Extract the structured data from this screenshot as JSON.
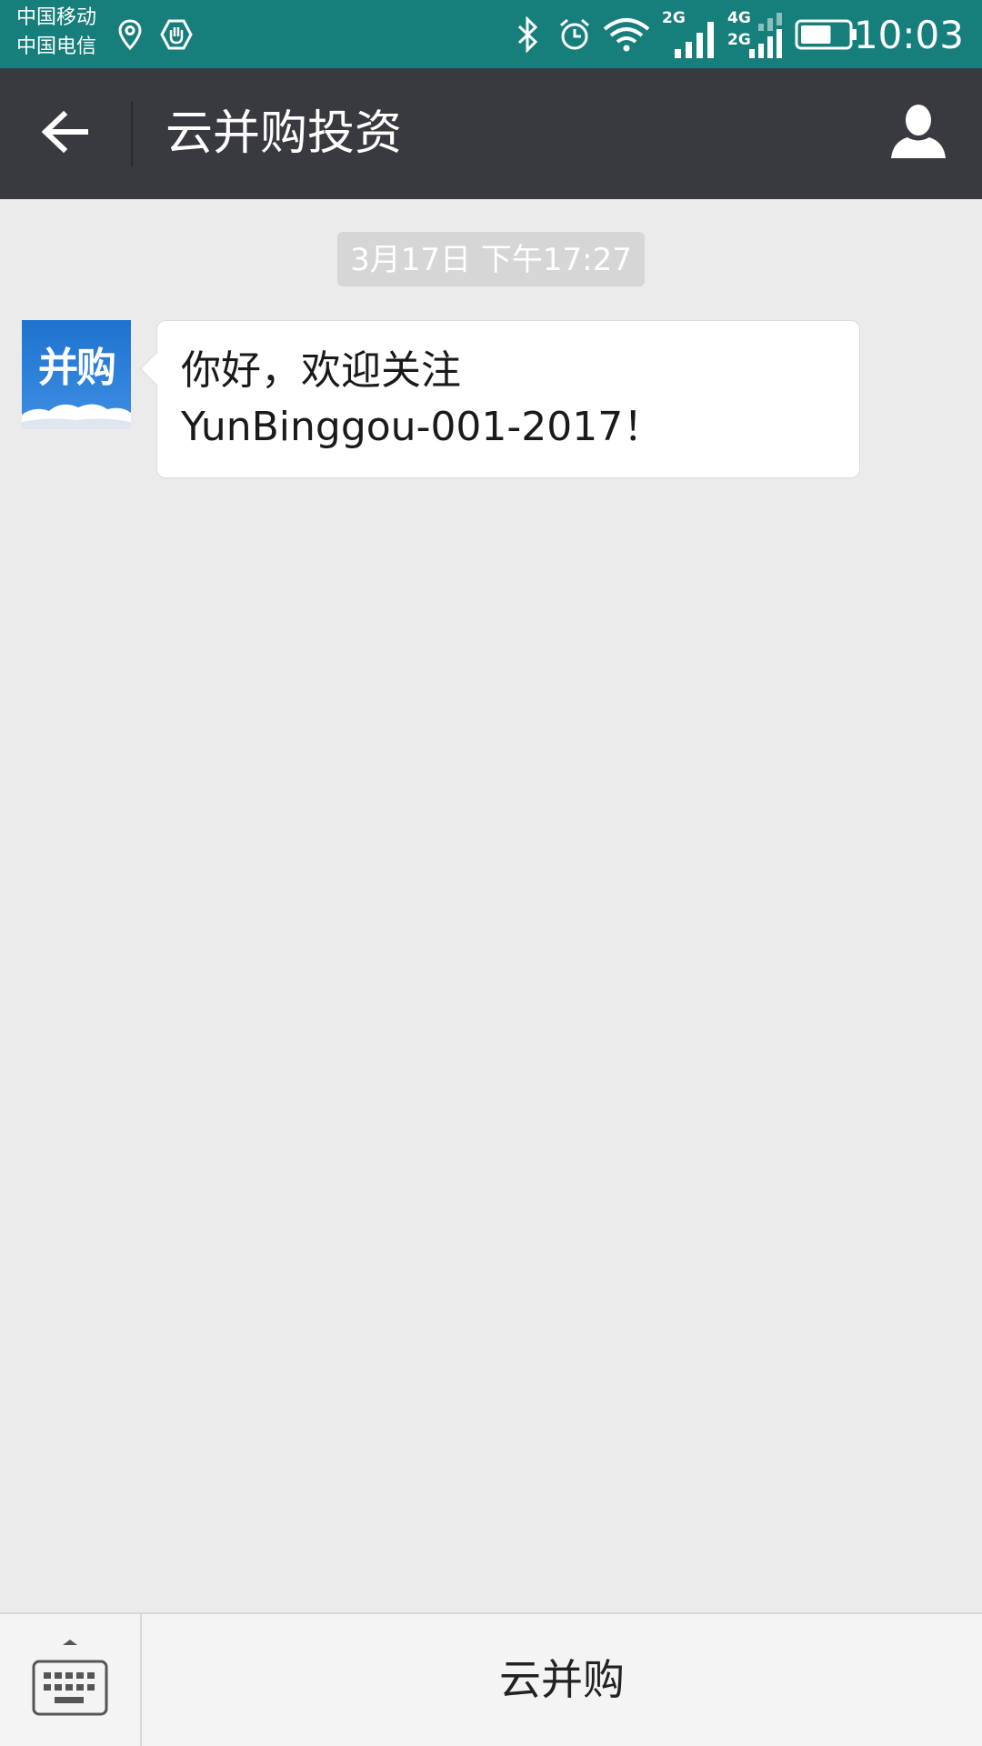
{
  "status_bar": {
    "carrier_1": "中国移动",
    "carrier_2": "中国电信",
    "net_1": "2G",
    "net_2_top": "4G",
    "net_2_bottom": "2G",
    "time": "10:03",
    "icons": [
      "location-icon",
      "hand-icon",
      "bluetooth-icon",
      "alarm-icon",
      "wifi-icon",
      "signal-icon",
      "battery-icon"
    ],
    "battery_level": 0.65
  },
  "header": {
    "title": "云并购投资",
    "back_icon": "arrow-left-icon",
    "profile_icon": "person-icon"
  },
  "chat": {
    "timestamp": "3月17日 下午17:27",
    "messages": [
      {
        "avatar_text": "并购",
        "line_1": "你好，欢迎关注",
        "line_2": "YunBinggou-001-2017！"
      }
    ]
  },
  "bottom_bar": {
    "keyboard_icon": "keyboard-icon",
    "menu_label": "云并购"
  },
  "colors": {
    "status_bar": "#167e7b",
    "nav_bar": "#393a3f",
    "chat_background": "#ebebeb",
    "bubble": "#ffffff",
    "timestamp_bg": "#d6d6d6"
  }
}
